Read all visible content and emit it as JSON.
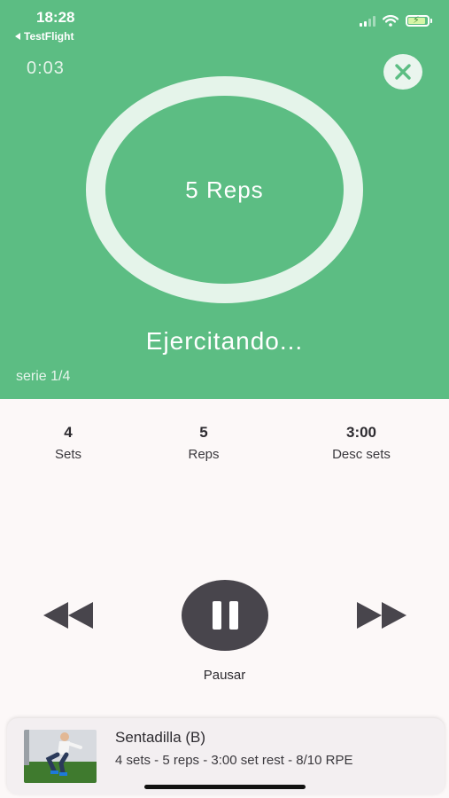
{
  "status_bar": {
    "time": "18:28",
    "back_app": "TestFlight",
    "icons": [
      "signal-icon",
      "wifi-icon",
      "battery-charging-icon"
    ]
  },
  "workout": {
    "elapsed": "0:03",
    "ring_label": "5 Reps",
    "state": "Ejercitando...",
    "set_counter": "serie 1/4",
    "close_icon": "close-icon"
  },
  "stats": [
    {
      "value": "4",
      "label": "Sets"
    },
    {
      "value": "5",
      "label": "Reps"
    },
    {
      "value": "3:00",
      "label": "Desc sets"
    }
  ],
  "controls": {
    "rewind_icon": "rewind-icon",
    "pause_icon": "pause-icon",
    "forward_icon": "fast-forward-icon",
    "pause_label": "Pausar"
  },
  "exercise_card": {
    "title": "Sentadilla (B)",
    "details": "4 sets - 5 reps - 3:00 set rest - 8/10 RPE"
  },
  "colors": {
    "accent_green": "#5cbd83",
    "ring": "#e5f4ea",
    "button_dark": "#48454c",
    "background": "#fcf8f8"
  }
}
